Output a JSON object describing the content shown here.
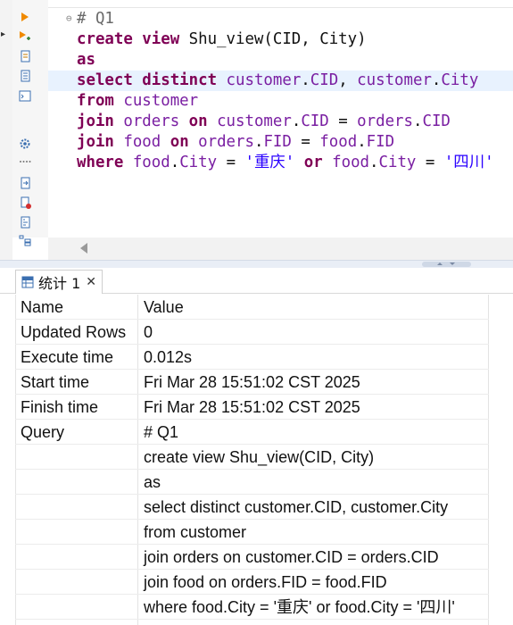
{
  "editor": {
    "lines": [
      [
        {
          "t": "# Q1",
          "c": "cmt"
        }
      ],
      [
        {
          "t": "create view ",
          "c": "kw"
        },
        {
          "t": "Shu_view(CID, City)",
          "c": "pl"
        }
      ],
      [
        {
          "t": "as",
          "c": "kw"
        }
      ],
      [
        {
          "t": "select distinct ",
          "c": "kw"
        },
        {
          "t": "customer",
          "c": "id"
        },
        {
          "t": ".",
          "c": "pn"
        },
        {
          "t": "CID",
          "c": "id"
        },
        {
          "t": ", ",
          "c": "pn"
        },
        {
          "t": "customer",
          "c": "id"
        },
        {
          "t": ".",
          "c": "pn"
        },
        {
          "t": "City",
          "c": "id"
        }
      ],
      [
        {
          "t": "from ",
          "c": "kw"
        },
        {
          "t": "customer",
          "c": "id"
        }
      ],
      [
        {
          "t": "join ",
          "c": "kw"
        },
        {
          "t": "orders ",
          "c": "id"
        },
        {
          "t": "on ",
          "c": "kw"
        },
        {
          "t": "customer",
          "c": "id"
        },
        {
          "t": ".",
          "c": "pn"
        },
        {
          "t": "CID",
          "c": "id"
        },
        {
          "t": " = ",
          "c": "pn"
        },
        {
          "t": "orders",
          "c": "id"
        },
        {
          "t": ".",
          "c": "pn"
        },
        {
          "t": "CID",
          "c": "id"
        }
      ],
      [
        {
          "t": "join ",
          "c": "kw"
        },
        {
          "t": "food ",
          "c": "id"
        },
        {
          "t": "on ",
          "c": "kw"
        },
        {
          "t": "orders",
          "c": "id"
        },
        {
          "t": ".",
          "c": "pn"
        },
        {
          "t": "FID",
          "c": "id"
        },
        {
          "t": " = ",
          "c": "pn"
        },
        {
          "t": "food",
          "c": "id"
        },
        {
          "t": ".",
          "c": "pn"
        },
        {
          "t": "FID",
          "c": "id"
        }
      ],
      [
        {
          "t": "where ",
          "c": "kw"
        },
        {
          "t": "food",
          "c": "id"
        },
        {
          "t": ".",
          "c": "pn"
        },
        {
          "t": "City",
          "c": "id"
        },
        {
          "t": " = ",
          "c": "pn"
        },
        {
          "t": "'重庆'",
          "c": "str"
        },
        {
          "t": " or ",
          "c": "kw"
        },
        {
          "t": "food",
          "c": "id"
        },
        {
          "t": ".",
          "c": "pn"
        },
        {
          "t": "City",
          "c": "id"
        },
        {
          "t": " = ",
          "c": "pn"
        },
        {
          "t": "'四川'",
          "c": "str"
        }
      ]
    ],
    "highlighted_line": 3
  },
  "colors": {
    "keyword": "#7f0055",
    "identifier": "#7a1fa2",
    "string": "#2a00ff",
    "highlight": "#e8f2fe"
  },
  "gutter_icons": [
    "run-icon",
    "run-add-icon",
    "script-icon",
    "script-list-icon",
    "console-icon",
    "settings-icon",
    "dots-icon",
    "export-icon",
    "error-log-icon",
    "explain-icon",
    "outline-icon"
  ],
  "results": {
    "tab_label": "统计 1",
    "header": {
      "name": "Name",
      "value": "Value"
    },
    "rows": [
      {
        "name": "Updated Rows",
        "value": "0"
      },
      {
        "name": "Execute time",
        "value": "0.012s"
      },
      {
        "name": "Start time",
        "value": "Fri Mar 28 15:51:02 CST 2025"
      },
      {
        "name": "Finish time",
        "value": "Fri Mar 28 15:51:02 CST 2025"
      },
      {
        "name": "Query",
        "value": "# Q1"
      },
      {
        "name": "",
        "value": "create view Shu_view(CID, City)"
      },
      {
        "name": "",
        "value": "as"
      },
      {
        "name": "",
        "value": "select distinct customer.CID, customer.City"
      },
      {
        "name": "",
        "value": "from customer"
      },
      {
        "name": "",
        "value": "join orders on customer.CID = orders.CID"
      },
      {
        "name": "",
        "value": "join food on orders.FID = food.FID"
      },
      {
        "name": "",
        "value": "where food.City = '重庆' or food.City = '四川'"
      }
    ]
  }
}
